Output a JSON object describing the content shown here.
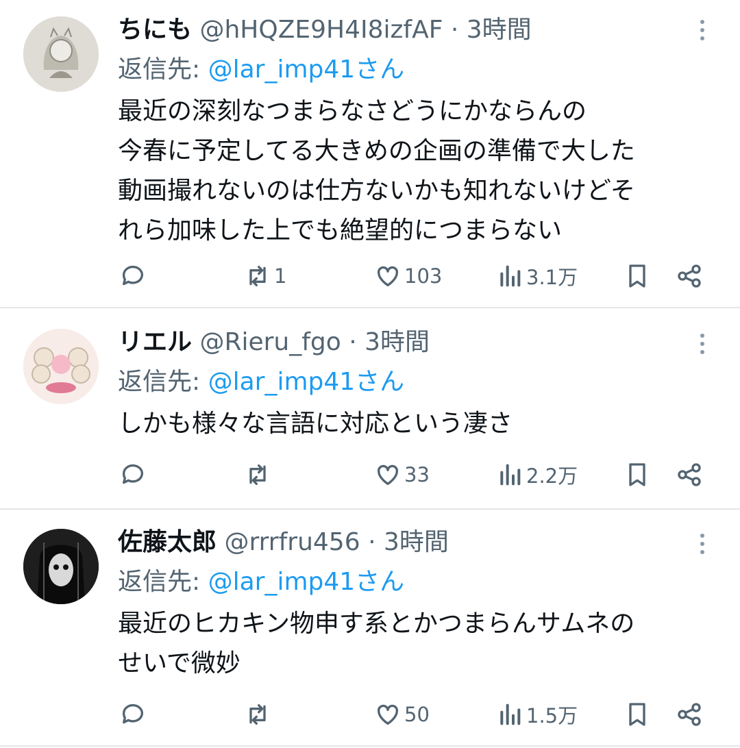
{
  "tweets": [
    {
      "name": "ちにも",
      "handle": "@hHQZE9H4I8izfAF",
      "time": "3時間",
      "reply_label": "返信先: ",
      "reply_mention": "@lar_imp41さん",
      "lines": [
        "最近の深刻なつまらなさどうにかならんの",
        "今春に予定してる大きめの企画の準備で大した",
        "動画撮れないのは仕方ないかも知れないけどそ",
        "れら加味した上でも絶望的につまらない"
      ],
      "retweets": "1",
      "likes": "103",
      "views": "3.1万",
      "avatar_color": "#d8d8d2"
    },
    {
      "name": "リエル",
      "handle": "@Rieru_fgo",
      "time": "3時間",
      "reply_label": "返信先: ",
      "reply_mention": "@lar_imp41さん",
      "lines": [
        "しかも様々な言語に対応という凄さ"
      ],
      "retweets": "",
      "likes": "33",
      "views": "2.2万",
      "avatar_color": "#f7e9e4"
    },
    {
      "name": "佐藤太郎",
      "handle": "@rrrfru456",
      "time": "3時間",
      "reply_label": "返信先: ",
      "reply_mention": "@lar_imp41さん",
      "lines": [
        "最近のヒカキン物申す系とかつまらんサムネの",
        "せいで微妙"
      ],
      "retweets": "",
      "likes": "50",
      "views": "1.5万",
      "avatar_color": "#2a2a2a"
    }
  ],
  "colors": {
    "text": "#0f1419",
    "secondary": "#536471",
    "mention": "#1d9bf0",
    "divider": "#e4e6e8"
  },
  "icons": [
    "more-icon",
    "reply-icon",
    "retweet-icon",
    "like-icon",
    "views-icon",
    "bookmark-icon",
    "share-icon"
  ]
}
